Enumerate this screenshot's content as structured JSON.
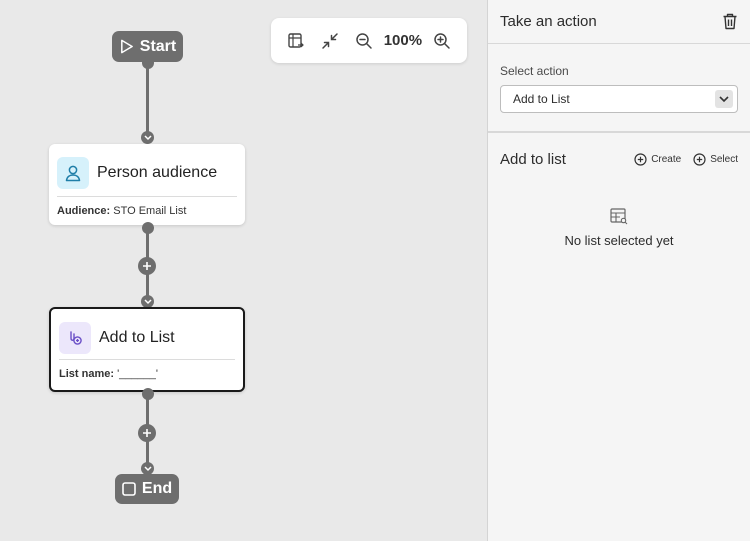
{
  "canvas": {
    "start_label": "Start",
    "end_label": "End",
    "nodes": [
      {
        "title": "Person audience",
        "detail_key": "Audience:",
        "detail_value": "STO Email List",
        "icon": "person-icon"
      },
      {
        "title": "Add to List",
        "detail_key": "List name:",
        "detail_value": "'______'",
        "icon": "link-list-icon"
      }
    ],
    "toolbar": {
      "zoom_level": "100%",
      "icons": [
        "fit-to-screen-icon",
        "collapse-icon",
        "zoom-out-icon",
        "zoom-in-icon"
      ]
    }
  },
  "panel": {
    "title": "Take an action",
    "select_label": "Select action",
    "select_value": "Add to List",
    "section_title": "Add to list",
    "create_label": "Create",
    "select_link_label": "Select",
    "empty_text": "No list selected yet"
  },
  "colors": {
    "connector": "#6e6e6e",
    "person_icon_bg": "#d6f1fb",
    "person_icon_fg": "#1f7ea8",
    "list_icon_bg": "#ece7fb",
    "list_icon_fg": "#6a4fc7"
  }
}
